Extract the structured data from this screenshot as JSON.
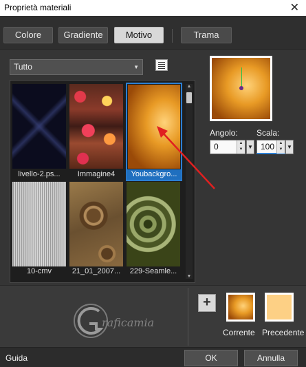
{
  "window": {
    "title": "Proprietà materiali",
    "close_glyph": "✕"
  },
  "tabs": [
    {
      "label": "Colore"
    },
    {
      "label": "Gradiente"
    },
    {
      "label": "Motivo",
      "active": true
    },
    {
      "label": "Trama"
    }
  ],
  "library": {
    "category": "Tutto",
    "items": [
      {
        "label": "livello-2.ps..."
      },
      {
        "label": "Immagine4"
      },
      {
        "label": "Youbackgro...",
        "selected": true
      },
      {
        "label": "10-cmv"
      },
      {
        "label": "21_01_2007..."
      },
      {
        "label": "229-Seamle..."
      }
    ]
  },
  "properties": {
    "angle_label": "Angolo:",
    "angle_value": "0",
    "scale_label": "Scala:",
    "scale_value": "100"
  },
  "swatches": {
    "current_label": "Corrente",
    "previous_label": "Precedente",
    "previous_color": "#fdd085"
  },
  "watermark": "Graficamia",
  "footer": {
    "help": "Guida",
    "ok": "OK",
    "cancel": "Annulla"
  },
  "colors": {
    "accent": "#2b7fd4",
    "annotation_arrow": "#e02020"
  }
}
